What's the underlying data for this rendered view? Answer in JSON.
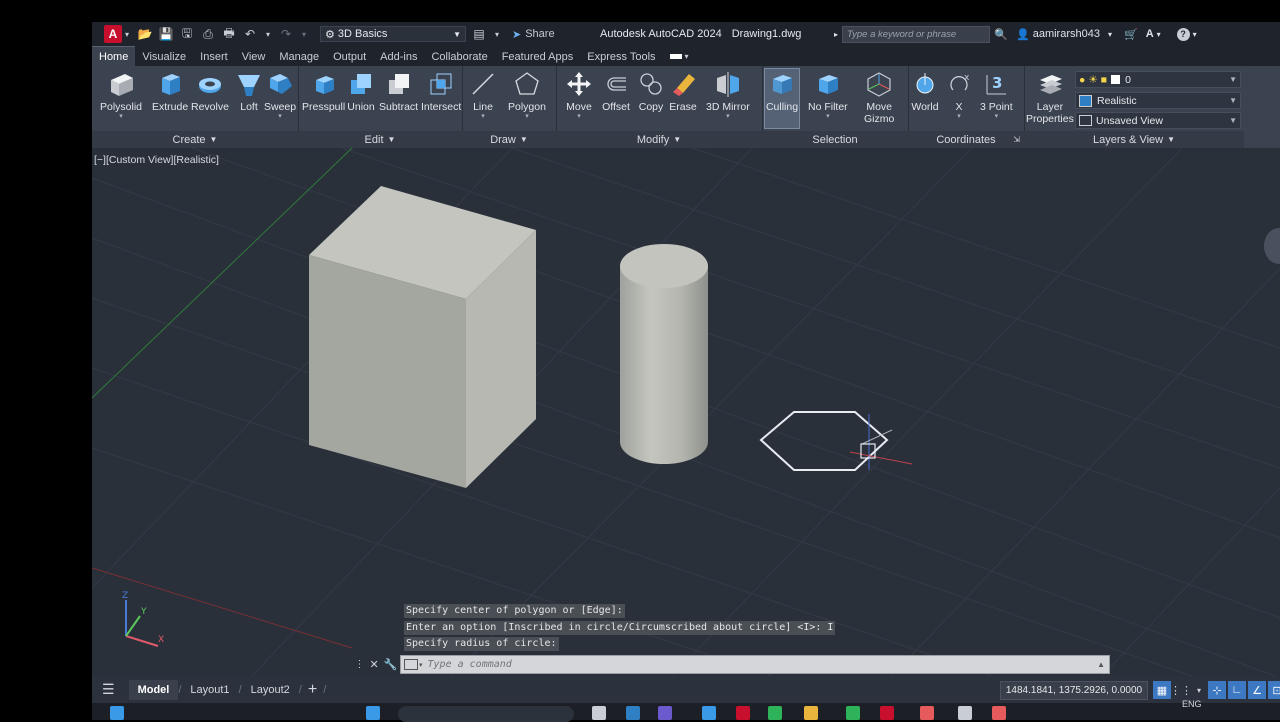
{
  "titlebar": {
    "logo": "A",
    "workspace": "3D Basics",
    "share_label": "Share",
    "app_title": "Autodesk AutoCAD 2024",
    "file_name": "Drawing1.dwg",
    "search_placeholder": "Type a keyword or phrase",
    "user": "aamirarsh043"
  },
  "tabs": [
    "Home",
    "Visualize",
    "Insert",
    "View",
    "Manage",
    "Output",
    "Add-ins",
    "Collaborate",
    "Featured Apps",
    "Express Tools"
  ],
  "ribbon": {
    "create": {
      "title": "Create",
      "buttons": [
        "Polysolid",
        "Extrude",
        "Revolve",
        "Loft",
        "Sweep"
      ]
    },
    "edit": {
      "title": "Edit",
      "buttons": [
        "Presspull",
        "Union",
        "Subtract",
        "Intersect"
      ]
    },
    "draw": {
      "title": "Draw",
      "buttons": [
        "Line",
        "Polygon"
      ]
    },
    "modify": {
      "title": "Modify",
      "buttons": [
        "Move",
        "Offset",
        "Copy",
        "Erase",
        "3D Mirror"
      ]
    },
    "selection": {
      "title": "Selection",
      "buttons": [
        "Culling",
        "No Filter",
        "Move",
        "Gizmo"
      ]
    },
    "coordinates": {
      "title": "Coordinates",
      "buttons": [
        "World",
        "X",
        "3 Point"
      ]
    },
    "layers": {
      "title": "Layers & View",
      "button_line1": "Layer",
      "button_line2": "Properties",
      "layer": "0",
      "visual_style": "Realistic",
      "view": "Unsaved View"
    }
  },
  "viewport": {
    "label": "[−][Custom View][Realistic]",
    "axis_labels": [
      "Z",
      "Y",
      "X"
    ]
  },
  "command": {
    "history": [
      "Specify center of polygon or [Edge]:",
      "Enter an option [Inscribed in circle/Circumscribed about circle] <I>: I",
      "Specify radius of circle:"
    ],
    "placeholder": "Type a command"
  },
  "status": {
    "tabs": [
      "Model",
      "Layout1",
      "Layout2"
    ],
    "add_label": "+",
    "coordinates": "1484.1841, 1375.2926, 0.0000"
  },
  "taskbar": {
    "lang": "ENG"
  },
  "colors": {
    "accent": "#3d78c2",
    "logo": "#c8102e",
    "viewport": "#2a303a",
    "ribbon": "#3b4250"
  }
}
